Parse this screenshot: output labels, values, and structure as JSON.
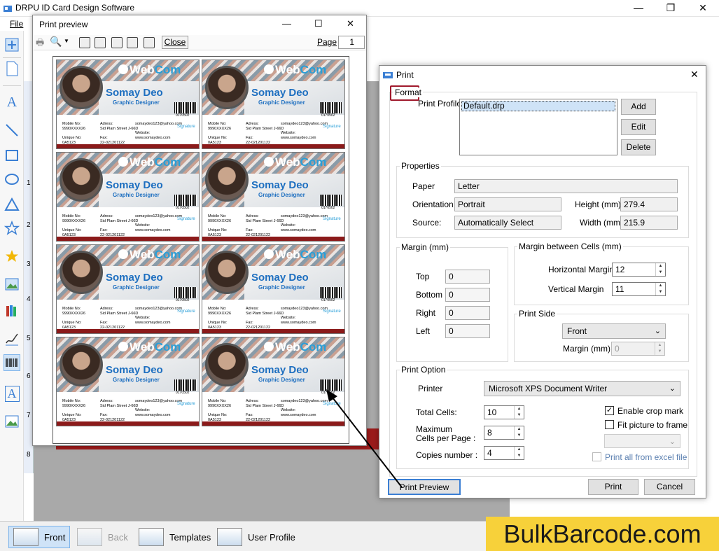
{
  "app": {
    "title": "DRPU ID Card Design Software",
    "menu_file": "File"
  },
  "window_controls": {
    "min": "—",
    "max": "❐",
    "close": "✕"
  },
  "ruler": {
    "ticks": [
      "1",
      "2",
      "3",
      "4",
      "5",
      "6",
      "7",
      "8"
    ]
  },
  "print_preview": {
    "title": "Print preview",
    "close_label": "Close",
    "page_label": "Page",
    "page_value": "1",
    "card": {
      "logo_prefix": "Web",
      "logo_suffix": "Com",
      "name": "Somay Deo",
      "role": "Graphic Designer",
      "barcode_number": "0170502",
      "mobile_label": "Mobile No:",
      "mobile": "9990XXXX26",
      "unique_label": "Unique No:",
      "unique": "0A5123",
      "address_label": "Adress:",
      "address": "Sid Plam Street J-66D",
      "fax_label": "Fax:",
      "fax": "22-021201122",
      "email": "somaydeo123@yahoo.com",
      "website_label": "Website:",
      "website": "www.somaydeo.com",
      "signature": "Signature"
    }
  },
  "print_dialog": {
    "title": "Print",
    "tab_format": "Format",
    "profile_label": "Print Profile",
    "profile_selected": "Default.drp",
    "btn_add": "Add",
    "btn_edit": "Edit",
    "btn_delete": "Delete",
    "properties_label": "Properties",
    "paper_label": "Paper",
    "paper_value": "Letter",
    "orientation_label": "Orientation",
    "orientation_value": "Portrait",
    "height_label": "Height (mm)",
    "height_value": "279.4",
    "source_label": "Source:",
    "source_value": "Automatically Select",
    "width_label": "Width (mm)",
    "width_value": "215.9",
    "margin_label": "Margin (mm)",
    "top_label": "Top",
    "top_value": "0",
    "bottom_label": "Bottom",
    "bottom_value": "0",
    "right_label": "Right",
    "right_value": "0",
    "left_label": "Left",
    "left_value": "0",
    "cell_margin_label": "Margin between Cells (mm)",
    "hmargin_label": "Horizontal Margin",
    "hmargin_value": "12",
    "vmargin_label": "Vertical Margin",
    "vmargin_value": "11",
    "print_side_label": "Print Side",
    "print_side_value": "Front",
    "side_margin_label": "Margin (mm)",
    "side_margin_value": "0",
    "print_option_label": "Print Option",
    "printer_label": "Printer",
    "printer_value": "Microsoft XPS Document Writer",
    "total_cells_label": "Total Cells:",
    "total_cells_value": "10",
    "max_cells_label_1": "Maximum",
    "max_cells_label_2": "Cells per Page :",
    "max_cells_value": "8",
    "copies_label": "Copies number :",
    "copies_value": "4",
    "crop_mark_label": "Enable crop mark",
    "fit_picture_label": "Fit picture to frame",
    "print_excel_label": "Print all from excel file",
    "btn_print_preview": "Print Preview",
    "btn_print": "Print",
    "btn_cancel": "Cancel"
  },
  "bottom_tabs": {
    "front": "Front",
    "back": "Back",
    "templates": "Templates",
    "user_profile": "User Profile"
  },
  "brand": "BulkBarcode.com"
}
